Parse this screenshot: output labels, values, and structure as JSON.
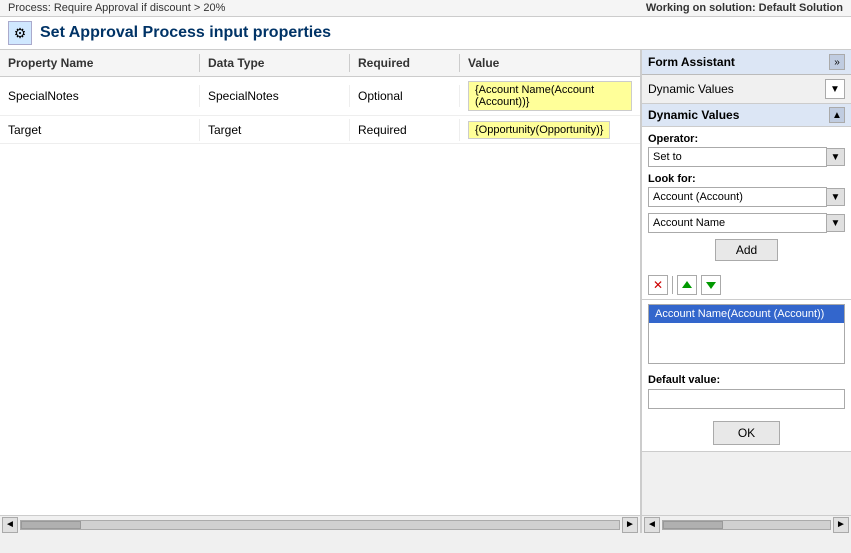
{
  "process_bar": {
    "text": "Process: Require Approval if discount > 20%"
  },
  "working_on": "Working on solution: Default Solution",
  "header": {
    "icon": "⚙",
    "title": "Set Approval Process input properties"
  },
  "table": {
    "columns": {
      "property_name": "Property Name",
      "data_type": "Data Type",
      "required": "Required",
      "value": "Value"
    },
    "rows": [
      {
        "property": "SpecialNotes",
        "data_type": "SpecialNotes",
        "required": "Optional",
        "value": "{Account Name(Account (Account))}"
      },
      {
        "property": "Target",
        "data_type": "Target",
        "required": "Required",
        "value": "{Opportunity(Opportunity)}"
      }
    ]
  },
  "form_assistant": {
    "title": "Form Assistant",
    "expand_icon": "»",
    "dynamic_values_dropdown": "Dynamic Values",
    "section_title": "Dynamic Values",
    "collapse_icon": "▲",
    "operator_label": "Operator:",
    "operator_value": "Set to",
    "look_for_label": "Look for:",
    "look_for_value": "Account (Account)",
    "field_value": "Account Name",
    "add_button": "Add",
    "delete_icon": "✕",
    "up_icon": "▲",
    "down_icon": "▼",
    "list_items": [
      {
        "text": "Account Name(Account (Account))",
        "selected": true
      }
    ],
    "default_value_label": "Default value:",
    "default_value": "",
    "ok_button": "OK",
    "left_arrow": "◄",
    "right_arrow": "►"
  },
  "scroll": {
    "left_arrow": "◄",
    "right_arrow": "►"
  }
}
